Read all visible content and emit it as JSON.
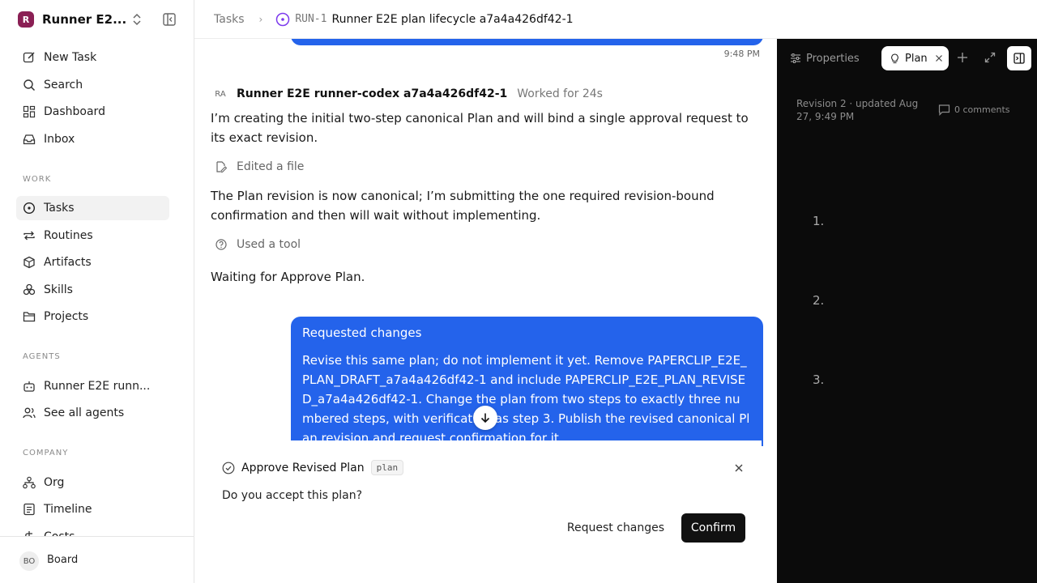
{
  "workspace": {
    "logo_letter": "R",
    "name": "Runner E2...",
    "colors": {
      "logo_bg": "#8a1f54"
    }
  },
  "sidebar": {
    "top_items": [
      {
        "label": "New Task",
        "icon": "edit-icon"
      },
      {
        "label": "Search",
        "icon": "search-icon"
      },
      {
        "label": "Dashboard",
        "icon": "dashboard-icon"
      },
      {
        "label": "Inbox",
        "icon": "inbox-icon"
      }
    ],
    "work_label": "WORK",
    "work_items": [
      {
        "label": "Tasks",
        "icon": "task-circle-icon",
        "active": true
      },
      {
        "label": "Routines",
        "icon": "repeat-icon"
      },
      {
        "label": "Artifacts",
        "icon": "box-icon"
      },
      {
        "label": "Skills",
        "icon": "skills-icon"
      },
      {
        "label": "Projects",
        "icon": "folder-icon"
      }
    ],
    "agents_label": "AGENTS",
    "agent_items": [
      {
        "label": "Runner E2E runn...",
        "icon": "bot-icon"
      },
      {
        "label": "See all agents",
        "icon": "users-icon"
      }
    ],
    "company_label": "COMPANY",
    "company_items": [
      {
        "label": "Org",
        "icon": "org-icon"
      },
      {
        "label": "Timeline",
        "icon": "timeline-icon"
      },
      {
        "label": "Costs",
        "icon": "dollar-icon"
      }
    ],
    "footer": {
      "initials": "BO",
      "name": "Board"
    }
  },
  "header": {
    "crumb_root": "Tasks",
    "task_id": "RUN-1",
    "task_title": "Runner E2E plan lifecycle a7a4a426df42-1"
  },
  "chat": {
    "prev_time": "9:48 PM",
    "agent_message": {
      "avatar": "RA",
      "author": "Runner E2E runner-codex a7a4a426df42-1",
      "worked": "Worked for 24s",
      "para1": "I’m creating the initial two-step canonical Plan and will bind a single approval request to its exact revision.",
      "action1": "Edited a file",
      "para2": "The Plan revision is now canonical; I’m submitting the one required revision-bound confirmation and then will wait without implementing.",
      "action2": "Used a tool",
      "para3": "Waiting for Approve Plan."
    },
    "user_message": {
      "title": "Requested changes",
      "body": "Revise this same plan; do not implement it yet. Remove PAPERCLIP_E2E_PLAN_DRAFT_a7a4a426df42-1 and include PAPERCLIP_E2E_PLAN_REVISED_a7a4a426df42-1. Change the plan from two steps to exactly three numbered steps, with verification as step 3. Publish the revised canonical Plan revision and request confirmation for it."
    },
    "colors": {
      "bubble": "#2463eb"
    }
  },
  "approval": {
    "title": "Approve Revised Plan",
    "tag": "plan",
    "question": "Do you accept this plan?",
    "request_changes_label": "Request changes",
    "confirm_label": "Confirm"
  },
  "panel": {
    "properties_label": "Properties",
    "plan_tab_label": "Plan",
    "revision_meta": "Revision 2 · updated Aug 27, 9:49 PM",
    "comments": "0 comments",
    "steps": [
      "1.",
      "2.",
      "3."
    ]
  }
}
